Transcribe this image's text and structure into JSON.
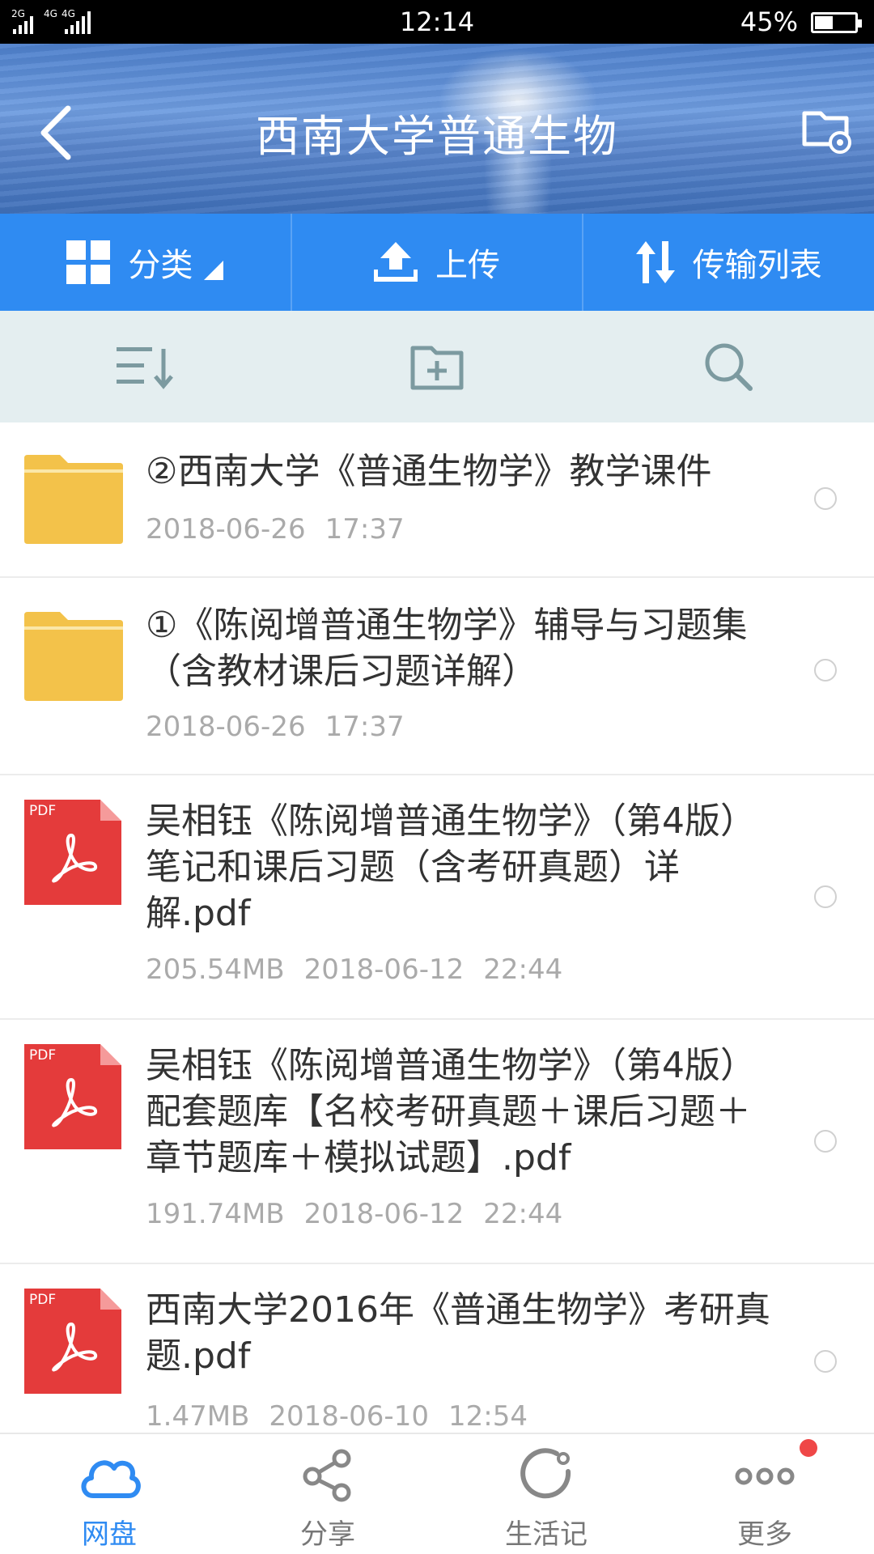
{
  "status_bar": {
    "signal_text": "2G 4G 4G",
    "time": "12:14",
    "battery_percent": "45%",
    "battery_level": 0.45
  },
  "header": {
    "title": "西南大学普通生物",
    "back_icon": "chevron-left-icon",
    "settings_icon": "folder-settings-icon"
  },
  "toolbar": {
    "category_label": "分类",
    "upload_label": "上传",
    "transfer_label": "传输列表"
  },
  "action_row": {
    "sort_icon": "sort-icon",
    "new_folder_icon": "folder-add-icon",
    "search_icon": "search-icon"
  },
  "files": [
    {
      "type": "folder",
      "name": "②西南大学《普通生物学》教学课件",
      "size": "",
      "date": "2018-06-26",
      "time": "17:37"
    },
    {
      "type": "folder",
      "name": "①《陈阅增普通生物学》辅导与习题集（含教材课后习题详解）",
      "size": "",
      "date": "2018-06-26",
      "time": "17:37"
    },
    {
      "type": "pdf",
      "name": "吴相钰《陈阅增普通生物学》（第4版）笔记和课后习题（含考研真题）详解.pdf",
      "size": "205.54MB",
      "date": "2018-06-12",
      "time": "22:44"
    },
    {
      "type": "pdf",
      "name": "吴相钰《陈阅增普通生物学》（第4版）配套题库【名校考研真题＋课后习题＋章节题库＋模拟试题】.pdf",
      "size": "191.74MB",
      "date": "2018-06-12",
      "time": "22:44"
    },
    {
      "type": "pdf",
      "name": "西南大学2016年《普通生物学》考研真题.pdf",
      "size": "1.47MB",
      "date": "2018-06-10",
      "time": "12:54"
    }
  ],
  "pdf_badge": "PDF",
  "bottom_nav": {
    "items": [
      {
        "label": "网盘",
        "icon": "cloud-icon",
        "active": true
      },
      {
        "label": "分享",
        "icon": "share-icon",
        "active": false
      },
      {
        "label": "生活记",
        "icon": "life-record-icon",
        "active": false
      },
      {
        "label": "更多",
        "icon": "more-icon",
        "active": false,
        "badge": true
      }
    ]
  },
  "colors": {
    "accent": "#2f8bf2",
    "pdf_red": "#e43b3b",
    "folder_yellow": "#f3c24a",
    "action_row_bg": "#e4eef0",
    "badge_red": "#ef4747"
  }
}
